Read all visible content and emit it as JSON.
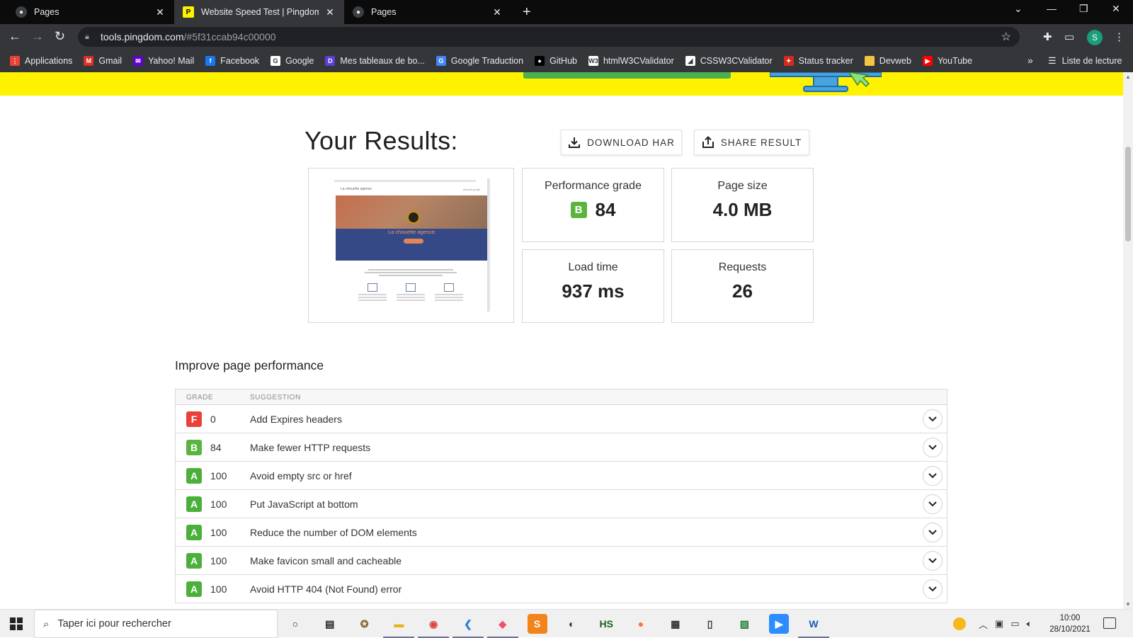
{
  "browser": {
    "tabs": [
      {
        "label": "Pages",
        "close": "✕"
      },
      {
        "label": "Website Speed Test | Pingdom To",
        "close": "✕"
      },
      {
        "label": "Pages",
        "close": "✕"
      }
    ],
    "new_tab": "+",
    "window_controls": [
      "⌄",
      "—",
      "❐",
      "✕"
    ],
    "url_host": "tools.pingdom.com",
    "url_path": "/#5f31ccab94c00000",
    "profile_initial": "S",
    "bookmarks": [
      {
        "label": "Applications",
        "color": "#ea4335",
        "glyph": "⋮"
      },
      {
        "label": "Gmail",
        "color": "#d93025",
        "glyph": "M"
      },
      {
        "label": "Yahoo! Mail",
        "color": "#6001d2",
        "glyph": "✉"
      },
      {
        "label": "Facebook",
        "color": "#1877f2",
        "glyph": "f"
      },
      {
        "label": "Google",
        "color": "#ffffff",
        "glyph": "G"
      },
      {
        "label": "Mes tableaux de bo...",
        "color": "#5c3ed6",
        "glyph": "D"
      },
      {
        "label": "Google Traduction",
        "color": "#4285f4",
        "glyph": "G"
      },
      {
        "label": "GitHub",
        "color": "#000000",
        "glyph": "●"
      },
      {
        "label": "htmlW3CValidator",
        "color": "#ffffff",
        "glyph": "W3"
      },
      {
        "label": "CSSW3CValidator",
        "color": "#ffffff",
        "glyph": "◢"
      },
      {
        "label": "Status tracker",
        "color": "#d52b1e",
        "glyph": "✦"
      },
      {
        "label": "Devweb",
        "color": "#f4c542",
        "glyph": " "
      },
      {
        "label": "YouTube",
        "color": "#ff0000",
        "glyph": "▶"
      }
    ],
    "bookmarks_more": "»",
    "reading_list": "Liste de lecture"
  },
  "page": {
    "results_title": "Your Results:",
    "download_har": "DOWNLOAD HAR",
    "share_result": "SHARE RESULT",
    "screenshot": {
      "hero_text": "La chouette agence.",
      "logo_text": "La chouette agence",
      "nav_text": "Accueil  projet"
    },
    "metrics": {
      "performance": {
        "label": "Performance grade",
        "grade": "B",
        "value": "84"
      },
      "page_size": {
        "label": "Page size",
        "value": "4.0 MB"
      },
      "load_time": {
        "label": "Load time",
        "value": "937 ms"
      },
      "requests": {
        "label": "Requests",
        "value": "26"
      }
    },
    "improve_title": "Improve page performance",
    "table_headers": {
      "grade": "GRADE",
      "suggestion": "SUGGESTION"
    },
    "suggestions": [
      {
        "grade": "F",
        "score": "0",
        "text": "Add Expires headers",
        "color": "#e8413b"
      },
      {
        "grade": "B",
        "score": "84",
        "text": "Make fewer HTTP requests",
        "color": "#5ab43e"
      },
      {
        "grade": "A",
        "score": "100",
        "text": "Avoid empty src or href",
        "color": "#4caf3c"
      },
      {
        "grade": "A",
        "score": "100",
        "text": "Put JavaScript at bottom",
        "color": "#4caf3c"
      },
      {
        "grade": "A",
        "score": "100",
        "text": "Reduce the number of DOM elements",
        "color": "#4caf3c"
      },
      {
        "grade": "A",
        "score": "100",
        "text": "Make favicon small and cacheable",
        "color": "#4caf3c"
      },
      {
        "grade": "A",
        "score": "100",
        "text": "Avoid HTTP 404 (Not Found) error",
        "color": "#4caf3c"
      }
    ],
    "colors": {
      "banner": "#fff200",
      "grade_b": "#5ab43e",
      "grade_a": "#4caf3c",
      "grade_f": "#e8413b"
    }
  },
  "taskbar": {
    "search_placeholder": "Taper ici pour rechercher",
    "time": "10:00",
    "date": "28/10/2021",
    "apps": [
      "task-view-icon",
      "widget-icon",
      "gimp-icon",
      "file-explorer-icon",
      "chrome-icon",
      "vscode-icon",
      "git-icon",
      "sublime-icon",
      "eclipse-icon",
      "heidisql-icon",
      "firefox-icon",
      "store-icon",
      "notepad-icon",
      "sheet-icon",
      "zoom-icon",
      "word-icon"
    ]
  }
}
